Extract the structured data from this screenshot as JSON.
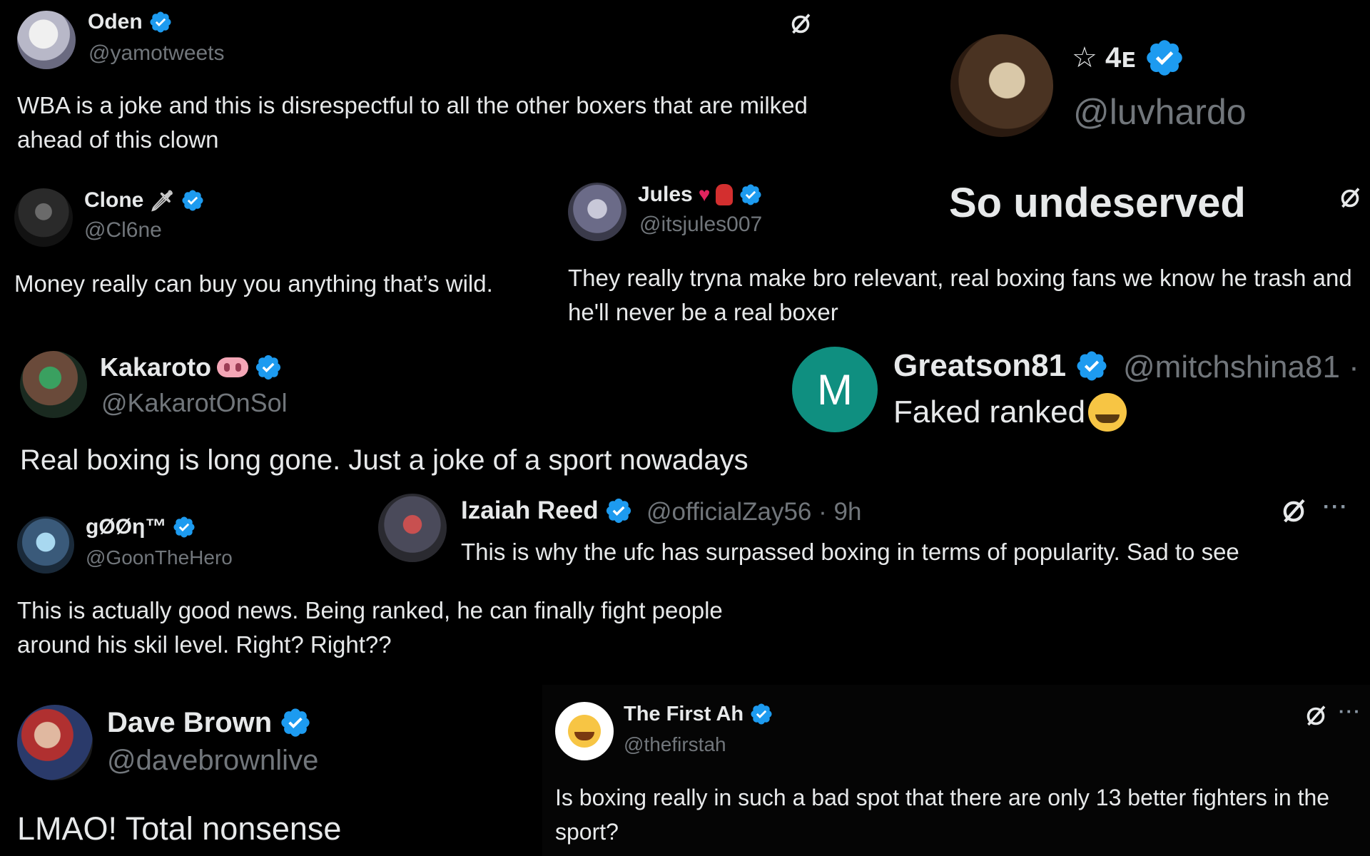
{
  "posts": [
    {
      "name": "Oden",
      "handle": "@yamotweets",
      "text": "WBA is a joke and this is disrespectful to all the other boxers that are milked ahead of this clown"
    },
    {
      "name": "☆ 4ᴇ",
      "handle": "@luvhardo",
      "text": "So undeserved"
    },
    {
      "name": "Clone",
      "handle": "@Cl6ne",
      "text": "Money really can buy you anything that’s wild."
    },
    {
      "name": "Jules",
      "handle": "@itsjules007",
      "text": "They really tryna make bro relevant, real boxing fans we know he trash and he'll never be a real boxer"
    },
    {
      "name": "Kakaroto",
      "handle": "@KakarotOnSol",
      "text": "Real boxing is long gone. Just a joke of a sport nowadays"
    },
    {
      "name": "Greatson81",
      "handle": "@mitchshina81 ·",
      "text": "Faked ranked",
      "avatar_letter": "M"
    },
    {
      "name": "gØØη™",
      "handle": "@GoonTheHero",
      "text": "This is actually good news. Being ranked, he can finally fight people around his skil level. Right? Right??"
    },
    {
      "name": "Izaiah Reed",
      "handle": "@officialZay56 · 9h",
      "text": "This is why the ufc has surpassed boxing in terms of popularity. Sad to see"
    },
    {
      "name": "Dave Brown",
      "handle": "@davebrownlive",
      "text": "LMAO! Total nonsense"
    },
    {
      "name": "The First Ah",
      "handle": "@thefirstah",
      "text": "Is boxing really in such a bad spot that there are only 13 better fighters in the sport?"
    }
  ],
  "icons": {
    "grok": "grok-icon",
    "more": "···",
    "verified": "verified-badge-icon"
  },
  "colors": {
    "background": "#000000",
    "text": "#e7e9ea",
    "muted": "#71767b",
    "verified": "#1d9bf0",
    "avatar_m": "#0f8f80"
  }
}
